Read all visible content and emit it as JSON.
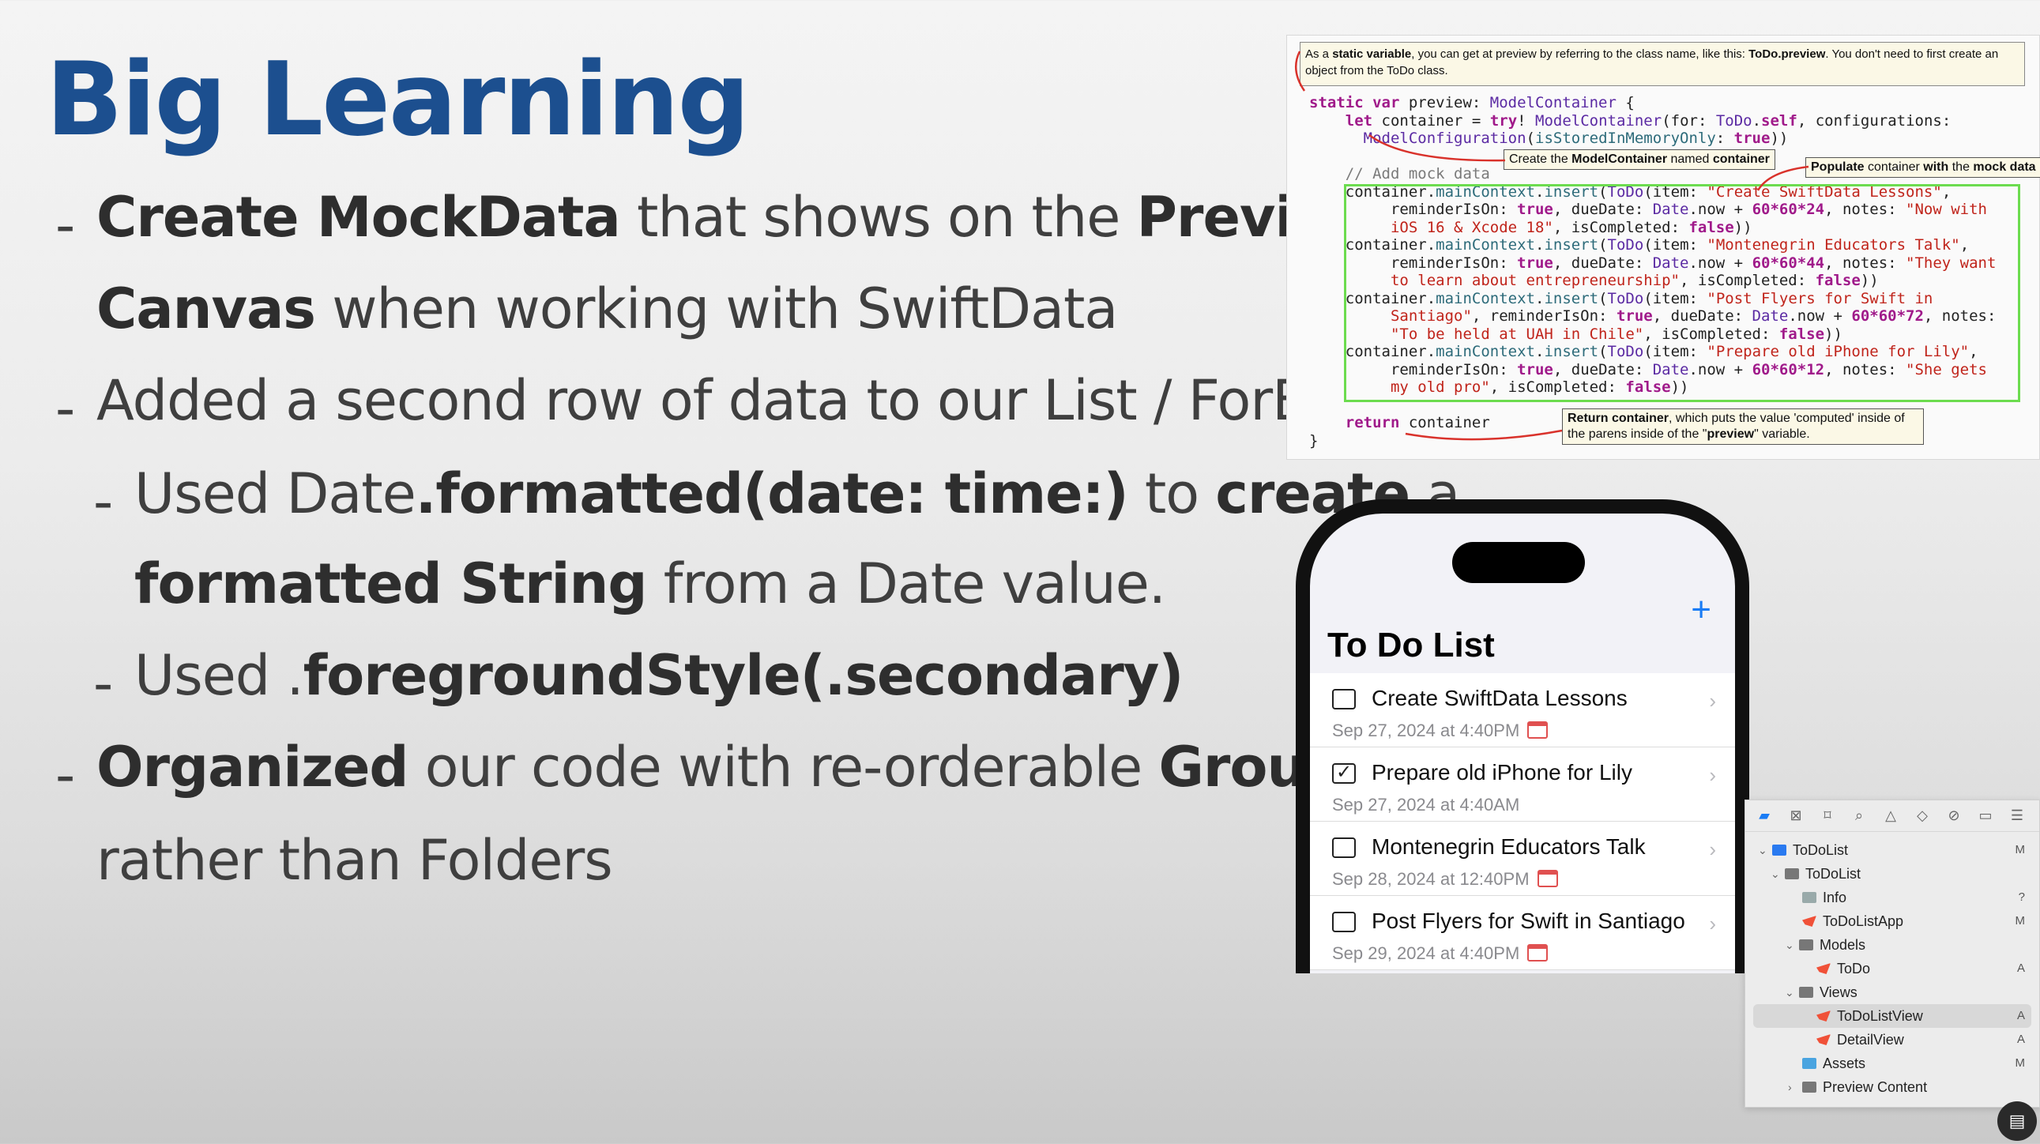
{
  "slide": {
    "title": "Big Learning",
    "b1_bold1": "Create MockData",
    "b1_text1": " that shows on the ",
    "b1_bold2": "Preview",
    "b1_bold3": "Canvas",
    "b1_text2": " when working with SwiftData",
    "b2_text": "Added a second row of data to our List / ForEach",
    "b3_text1": "Used Date",
    "b3_bold1": ".formatted(date: time:)",
    "b3_text2": " to ",
    "b3_bold2": "create",
    "b3_text3": " a",
    "b3_bold3": "formatted String",
    "b3_text4": " from a Date value.",
    "b4_text1": "Used .",
    "b4_bold1": "foregroundStyle(.secondary)",
    "b5_bold1": "Organized",
    "b5_text1": " our code with re-orderable ",
    "b5_bold2": "Groups",
    "b5_text2": "rather than Folders",
    "dash": "-"
  },
  "code_panel": {
    "note_prefix": "As a ",
    "note_bold1": "static variable",
    "note_mid": ", you can get at preview by referring to the class name, like this: ",
    "note_bold2": "ToDo.preview",
    "note_suffix": ". You don't need to first create an object from the ToDo class.",
    "callout_create_prefix": "Create the ",
    "callout_create_bold": "ModelContainer",
    "callout_create_suffix": " named ",
    "callout_create_bold2": "container",
    "callout_populate_bold1": "Populate",
    "callout_populate_mid": " container ",
    "callout_populate_bold2": "with",
    "callout_populate_suffix": " the ",
    "callout_populate_bold3": "mock data",
    "callout_return_bold": "Return container",
    "callout_return_text": ", which puts the value 'computed' inside of the parens inside of the \"",
    "callout_return_bold2": "preview",
    "callout_return_end": "\" variable."
  },
  "phone": {
    "add_icon": "+",
    "list_title": "To Do List",
    "chevron": "›",
    "check": "✓",
    "todos": [
      {
        "item": "Create SwiftData Lessons",
        "due": "Sep 27, 2024 at 4:40PM",
        "completed": false,
        "reminder": true
      },
      {
        "item": "Prepare old iPhone for Lily",
        "due": "Sep 27, 2024 at 4:40AM",
        "completed": true,
        "reminder": false
      },
      {
        "item": "Montenegrin Educators Talk",
        "due": "Sep 28, 2024 at 12:40PM",
        "completed": false,
        "reminder": true
      },
      {
        "item": "Post Flyers for Swift in Santiago",
        "due": "Sep 29, 2024 at 4:40PM",
        "completed": false,
        "reminder": true
      }
    ]
  },
  "navigator": {
    "rows": [
      {
        "label": "ToDoList",
        "status": "M"
      },
      {
        "label": "ToDoList",
        "status": ""
      },
      {
        "label": "Info",
        "status": "?"
      },
      {
        "label": "ToDoListApp",
        "status": "M"
      },
      {
        "label": "Models",
        "status": ""
      },
      {
        "label": "ToDo",
        "status": "A"
      },
      {
        "label": "Views",
        "status": ""
      },
      {
        "label": "ToDoListView",
        "status": "A"
      },
      {
        "label": "DetailView",
        "status": "A"
      },
      {
        "label": "Assets",
        "status": "M"
      },
      {
        "label": "Preview Content",
        "status": ""
      }
    ]
  },
  "colors": {
    "title_blue": "#1c4f8f",
    "accent_blue": "#1a7cf5",
    "mock_box_green": "#6cdc4f",
    "arrow_red": "#d9322b"
  }
}
